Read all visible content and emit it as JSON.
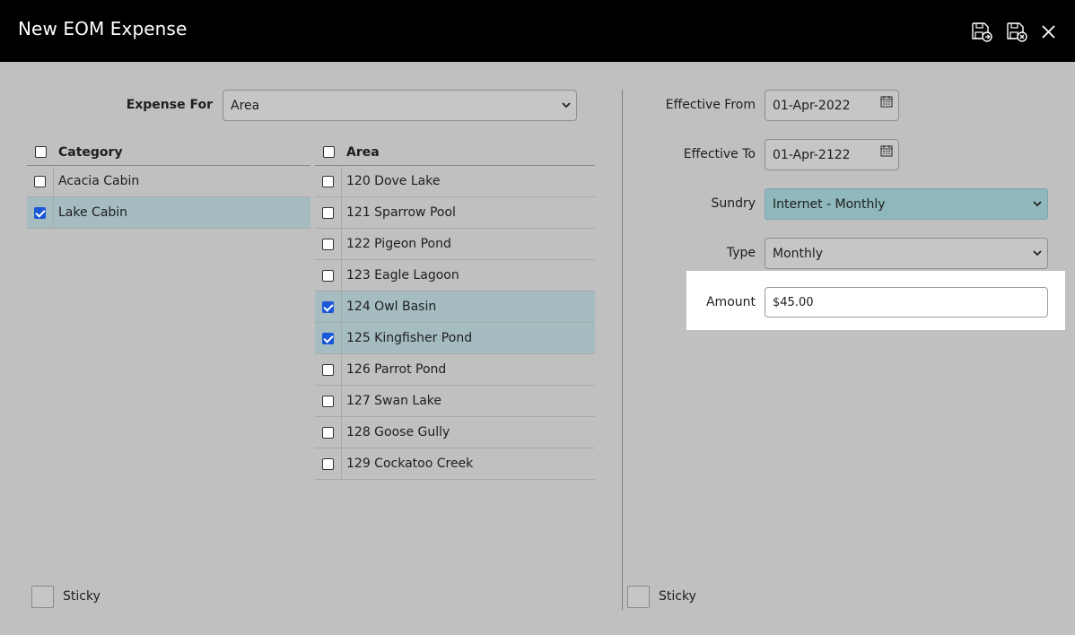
{
  "window": {
    "title": "New EOM Expense"
  },
  "toolbar": {
    "save_icon": "save-add-icon",
    "discard_icon": "save-close-icon",
    "close_icon": "close-icon"
  },
  "expense_for": {
    "label": "Expense For",
    "value": "Area"
  },
  "category_table": {
    "header": "Category",
    "rows": [
      {
        "label": "Acacia Cabin",
        "checked": false
      },
      {
        "label": "Lake Cabin",
        "checked": true
      }
    ]
  },
  "area_table": {
    "header": "Area",
    "rows": [
      {
        "label": "120 Dove Lake",
        "checked": false
      },
      {
        "label": "121 Sparrow Pool",
        "checked": false
      },
      {
        "label": "122 Pigeon Pond",
        "checked": false
      },
      {
        "label": "123 Eagle Lagoon",
        "checked": false
      },
      {
        "label": "124 Owl Basin",
        "checked": true
      },
      {
        "label": "125 Kingfisher Pond",
        "checked": true
      },
      {
        "label": "126 Parrot Pond",
        "checked": false
      },
      {
        "label": "127 Swan Lake",
        "checked": false
      },
      {
        "label": "128 Goose Gully",
        "checked": false
      },
      {
        "label": "129 Cockatoo Creek",
        "checked": false
      }
    ]
  },
  "form": {
    "effective_from": {
      "label": "Effective From",
      "value": "01-Apr-2022"
    },
    "effective_to": {
      "label": "Effective To",
      "value": "01-Apr-2122"
    },
    "sundry": {
      "label": "Sundry",
      "value": "Internet - Monthly"
    },
    "type": {
      "label": "Type",
      "value": "Monthly"
    },
    "amount": {
      "label": "Amount",
      "value": "$45.00"
    }
  },
  "sticky_left": {
    "label": "Sticky"
  },
  "sticky_right": {
    "label": "Sticky"
  },
  "colors": {
    "titlebar": "#000000",
    "background": "#c0c0c0",
    "selected_row": "#a5bcc1",
    "sundry_select": "#8fb8bc",
    "checkbox_checked": "#1a56d8"
  }
}
